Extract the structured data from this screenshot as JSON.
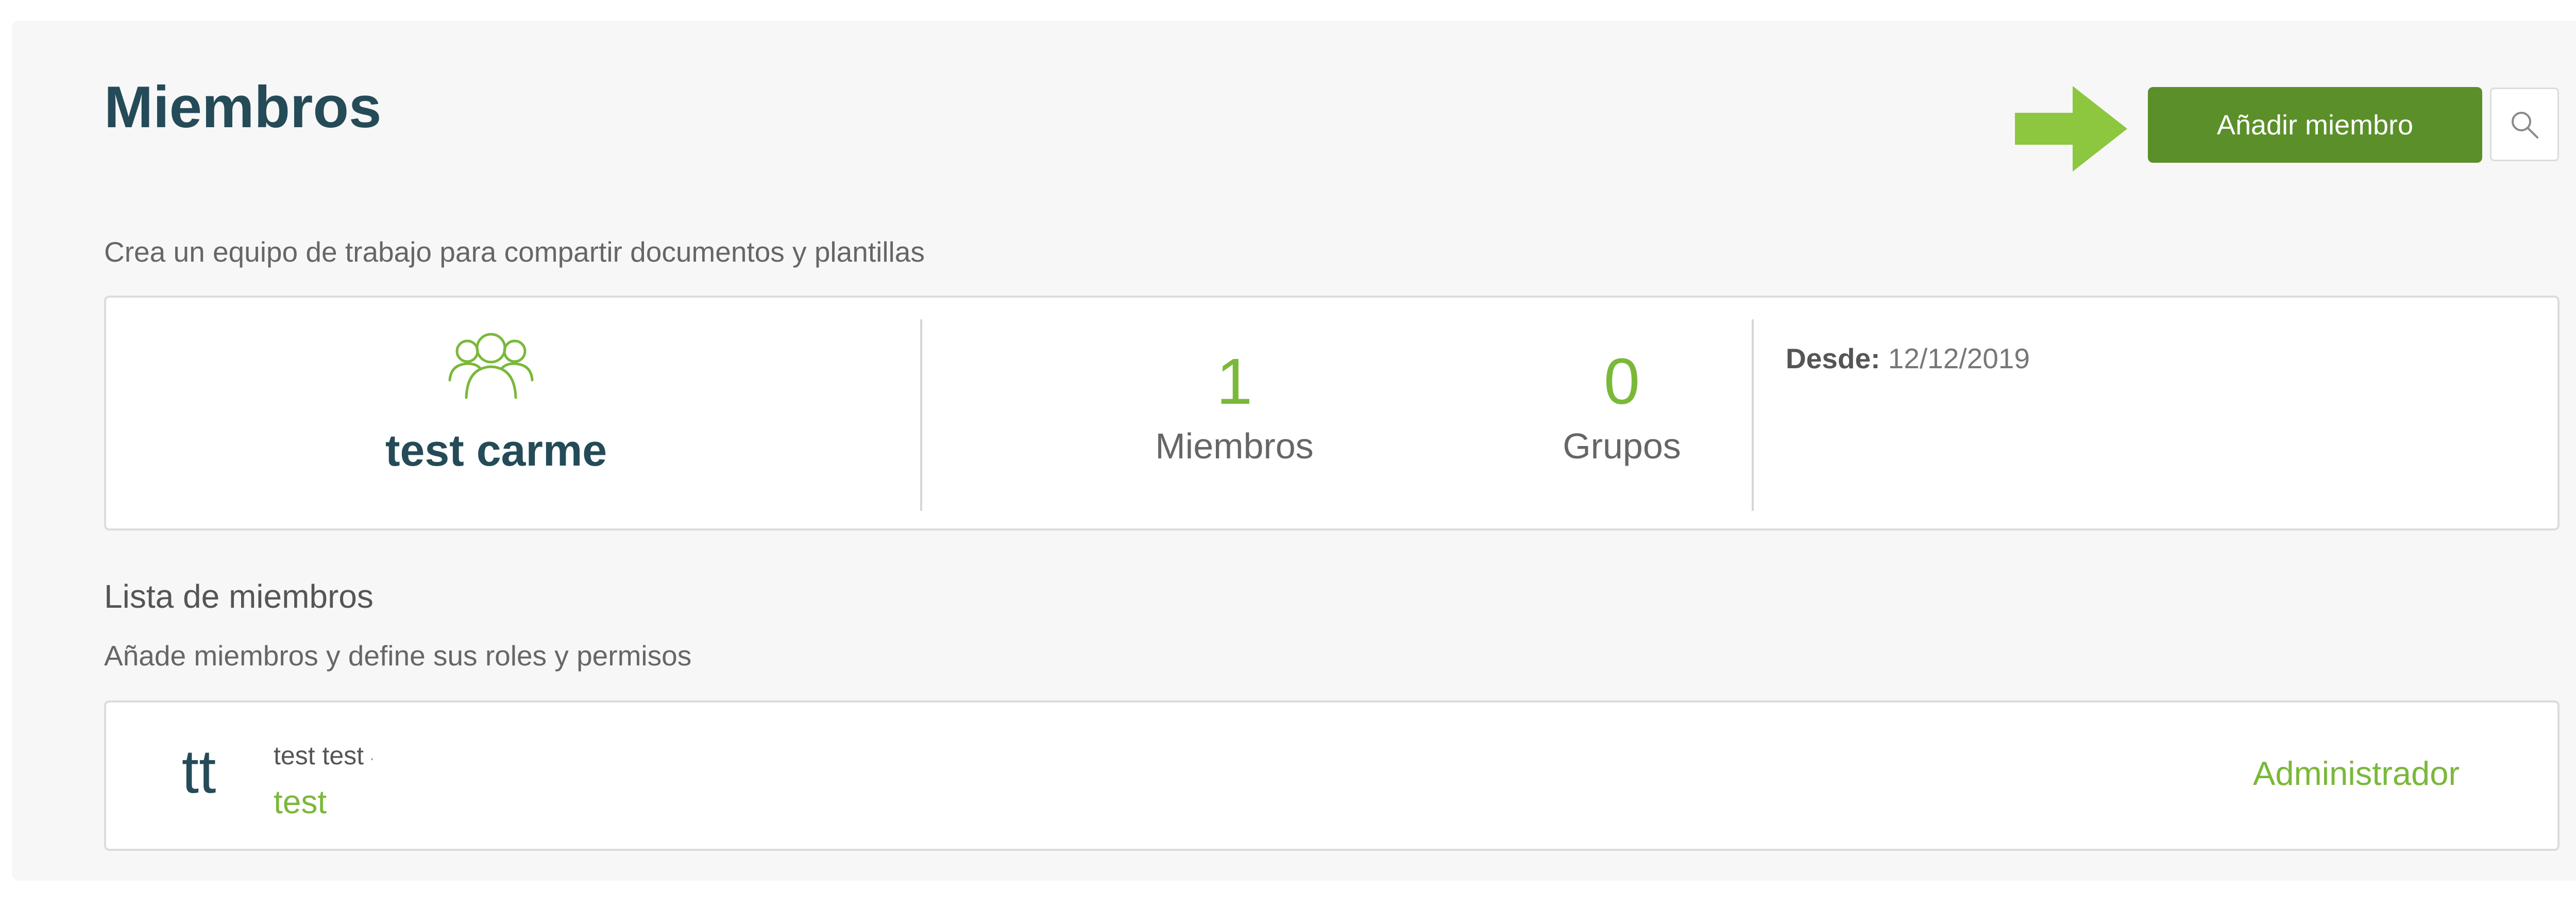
{
  "header": {
    "title": "Miembros",
    "add_member_label": "Añadir miembro",
    "search_icon": "search-icon",
    "arrow_icon": "arrow-right-icon"
  },
  "team": {
    "subtitle": "Crea un equipo de trabajo para compartir documentos y plantillas",
    "icon": "group-icon",
    "name": "test carme",
    "stats": [
      {
        "value": "1",
        "label": "Miembros"
      },
      {
        "value": "0",
        "label": "Grupos"
      }
    ],
    "since_label": "Desde:",
    "since_value": "12/12/2019"
  },
  "members": {
    "heading": "Lista de miembros",
    "subtitle": "Añade miembros y define sus roles y permisos",
    "items": [
      {
        "initials": "tt",
        "full_name": "test test",
        "separator": "·",
        "username": "test",
        "role": "Administrador"
      }
    ]
  },
  "colors": {
    "primary_button": "#5b8f2a",
    "accent_green": "#7ab83a",
    "arrow_green": "#8dc63f",
    "title_dark": "#244b57"
  }
}
